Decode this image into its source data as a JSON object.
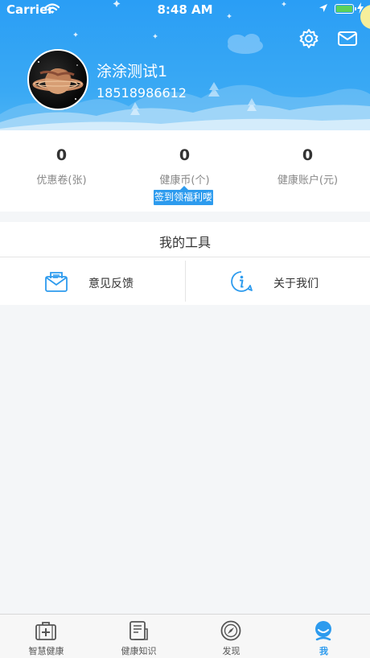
{
  "status_bar": {
    "carrier": "Carrier",
    "time": "8:48 AM",
    "wifi_icon": "wifi-icon",
    "location_icon": "location-arrow-icon",
    "battery_icon": "battery-icon",
    "battery_color": "#5bd15b"
  },
  "header": {
    "background_color": "#3aa9f4",
    "settings_icon": "gear-icon",
    "message_icon": "mail-icon"
  },
  "profile": {
    "name": "涂涂测试1",
    "phone": "18518986612"
  },
  "stats": [
    {
      "value": "0",
      "label": "优惠卷(张)"
    },
    {
      "value": "0",
      "label": "健康币(个)"
    },
    {
      "value": "0",
      "label": "健康账户(元)"
    }
  ],
  "sign_badge": "签到领福利喽",
  "tools": {
    "title": "我的工具",
    "items": [
      {
        "label": "意见反馈",
        "icon": "feedback-envelope-icon"
      },
      {
        "label": "关于我们",
        "icon": "info-icon"
      }
    ]
  },
  "tabbar": {
    "accent_color": "#2d9bee",
    "tabs": [
      {
        "label": "智慧健康",
        "icon": "medical-kit-icon",
        "active": false
      },
      {
        "label": "健康知识",
        "icon": "document-list-icon",
        "active": false
      },
      {
        "label": "发现",
        "icon": "compass-icon",
        "active": false
      },
      {
        "label": "我",
        "icon": "user-icon",
        "active": true
      }
    ]
  }
}
